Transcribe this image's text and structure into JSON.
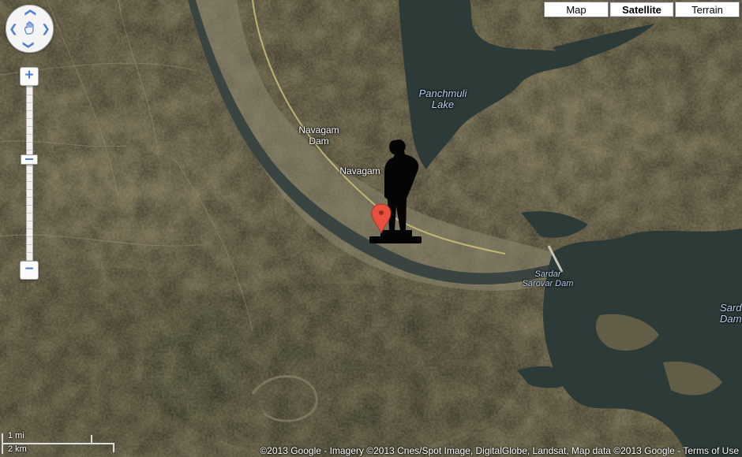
{
  "map_type_control": {
    "options": [
      "Map",
      "Satellite",
      "Terrain"
    ],
    "selected": "Satellite"
  },
  "zoom_control": {
    "zoom_in_label": "+",
    "zoom_out_label": "−",
    "zoom_level_fraction": 0.44
  },
  "labels": {
    "panchmuli_lake": [
      "Panchmuli",
      "Lake"
    ],
    "navagam_dam": [
      "Navagam",
      "Dam"
    ],
    "navagam": "Navagam",
    "sardar_sarovar_dam": [
      "Sardar",
      "Sarovar Dam"
    ],
    "sardar_partial": [
      "Sard",
      "Dam"
    ]
  },
  "scale_bar": {
    "imperial": "1 mi",
    "metric": "2 km"
  },
  "attribution": {
    "text": "©2013 Google - Imagery ©2013 Cnes/Spot Image, DigitalGlobe, Landsat, Map data ©2013 Google -",
    "terms_link": "Terms of Use"
  },
  "icons": {
    "marker": "map-pin-icon",
    "statue": "statue-silhouette-icon",
    "pan": "hand-pan-icon"
  },
  "colors": {
    "marker": "#e8503f",
    "water": "#2c3a38",
    "terrain": "#6b6449",
    "control_blue": "#4f7fcf"
  }
}
